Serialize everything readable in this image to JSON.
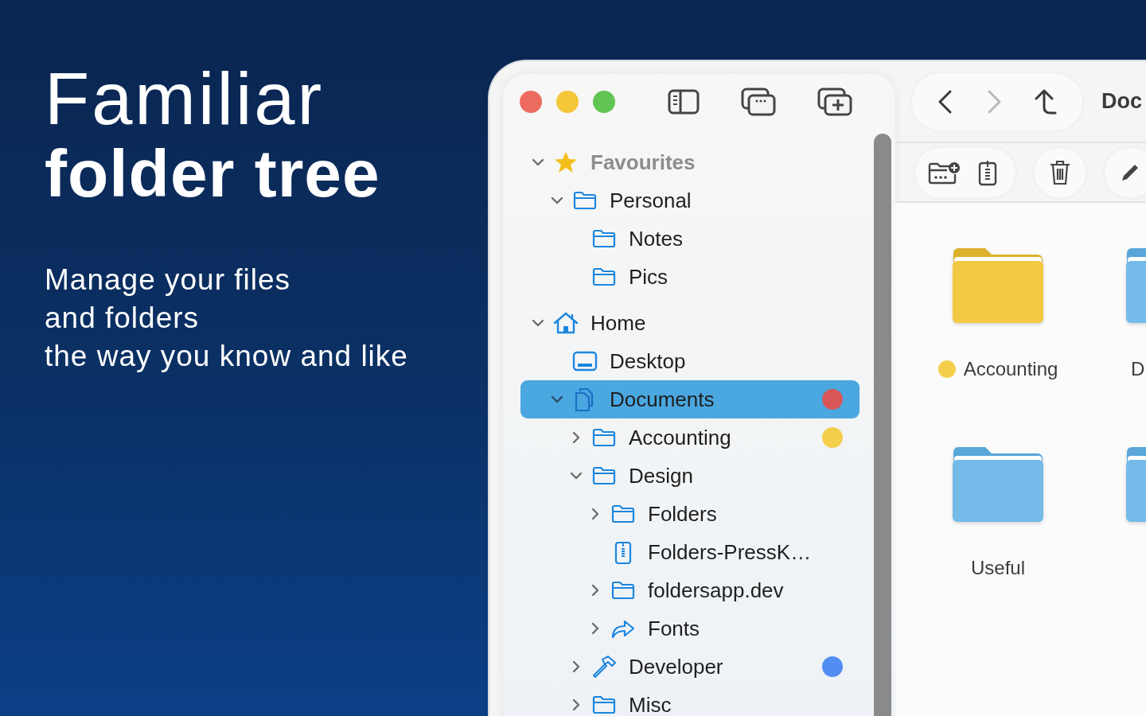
{
  "hero": {
    "title_light": "Familiar",
    "title_bold": "folder tree",
    "subtitle_lines": [
      "Manage your files",
      "and folders",
      "the way you know and like"
    ]
  },
  "nav_buttons": [
    {
      "kind": "back",
      "disabled": false
    },
    {
      "kind": "forward",
      "disabled": true
    },
    {
      "kind": "up",
      "disabled": false
    }
  ],
  "window": {
    "title": "Doc"
  },
  "sidebar": {
    "tree": [
      {
        "label": "Favourites",
        "kind": "star",
        "expanded": true,
        "selected": false,
        "children": [
          {
            "label": "Personal",
            "kind": "folder",
            "expanded": true,
            "selected": false,
            "children": [
              {
                "label": "Notes",
                "kind": "folder",
                "selected": false
              },
              {
                "label": "Pics",
                "kind": "folder",
                "selected": false
              }
            ]
          }
        ]
      },
      {
        "label": "Home",
        "kind": "home",
        "expanded": true,
        "selected": false,
        "children": [
          {
            "label": "Desktop",
            "kind": "desktop",
            "selected": false
          },
          {
            "label": "Documents",
            "kind": "documents",
            "expanded": true,
            "selected": true,
            "color": "#d95656",
            "children": [
              {
                "label": "Accounting",
                "kind": "folder",
                "expanded": false,
                "selected": false,
                "color": "#f5cf4c"
              },
              {
                "label": "Design",
                "kind": "folder",
                "expanded": true,
                "selected": false,
                "children": [
                  {
                    "label": "Folders",
                    "kind": "folder",
                    "expanded": false,
                    "selected": false
                  },
                  {
                    "label": "Folders-PressK…",
                    "kind": "archive",
                    "selected": false
                  },
                  {
                    "label": "foldersapp.dev",
                    "kind": "folder",
                    "expanded": false,
                    "selected": false
                  },
                  {
                    "label": "Fonts",
                    "kind": "alias",
                    "expanded": false,
                    "selected": false
                  }
                ]
              },
              {
                "label": "Developer",
                "kind": "hammer",
                "expanded": false,
                "selected": false,
                "color": "#528ef2"
              },
              {
                "label": "Misc",
                "kind": "folder",
                "expanded": false,
                "selected": false
              }
            ]
          }
        ]
      }
    ]
  },
  "content": {
    "items": [
      {
        "name": "Accounting",
        "kind": "folder",
        "color": "#f5cf4c"
      },
      {
        "name": "D",
        "kind": "folder"
      },
      {
        "name": "Useful",
        "kind": "folder"
      },
      {
        "kind": "folder"
      }
    ]
  }
}
